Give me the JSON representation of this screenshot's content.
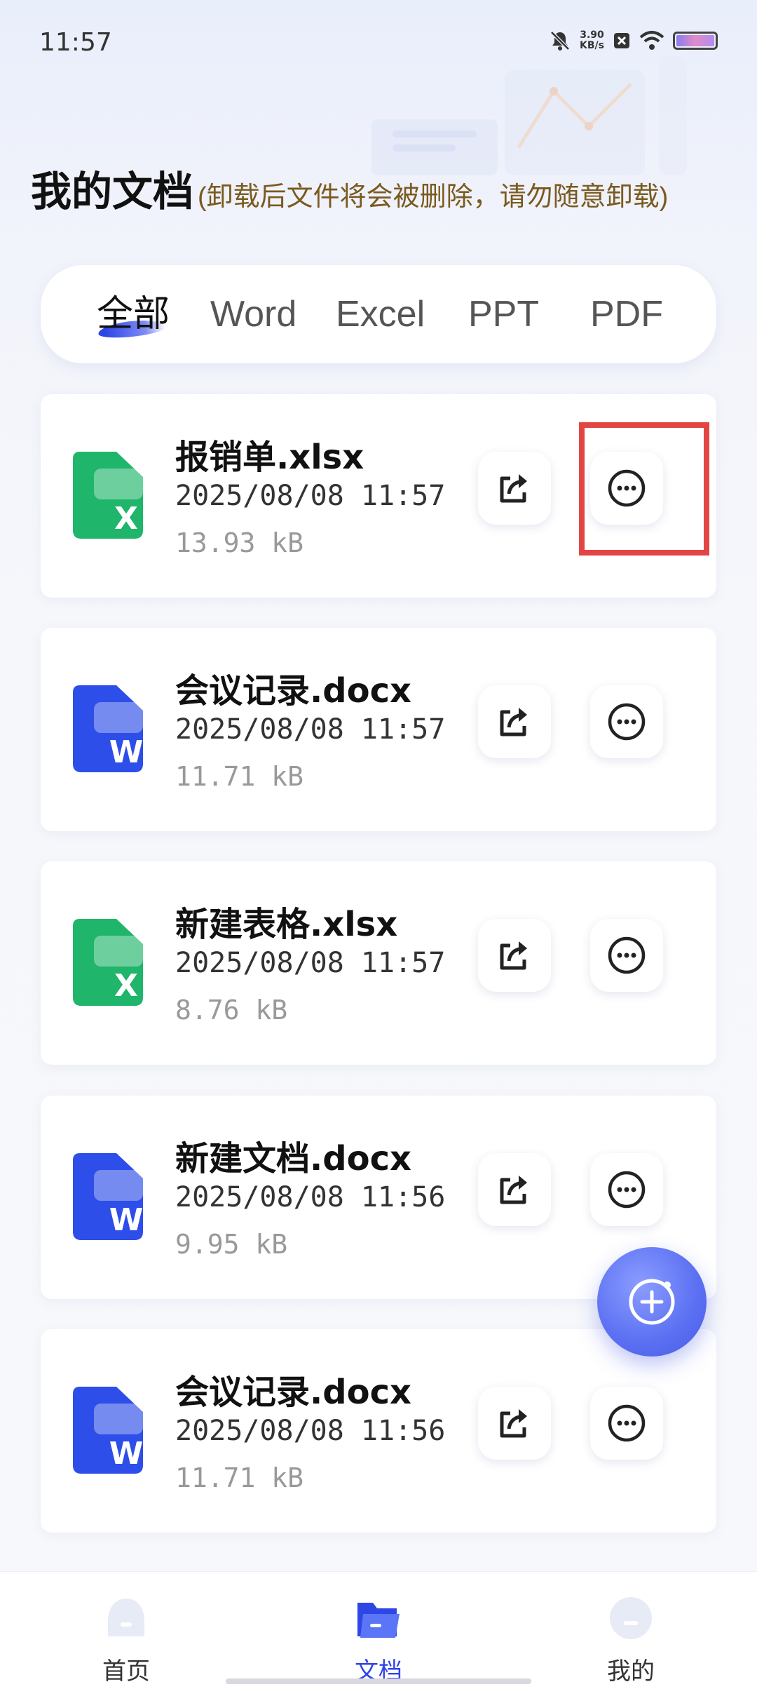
{
  "status_bar": {
    "time": "11:57",
    "speed_value": "3.90",
    "speed_unit": "KB/s",
    "icons": [
      "bell-off-icon",
      "sim-x-icon",
      "wifi-icon",
      "battery-icon"
    ]
  },
  "header": {
    "title": "我的文档",
    "note": "(卸载后文件将会被删除，请勿随意卸载)"
  },
  "tabs": [
    {
      "label": "全部",
      "active": true
    },
    {
      "label": "Word",
      "active": false
    },
    {
      "label": "Excel",
      "active": false
    },
    {
      "label": "PPT",
      "active": false
    },
    {
      "label": "PDF",
      "active": false
    }
  ],
  "files": [
    {
      "name": "报销单.xlsx",
      "date": "2025/08/08 11:57",
      "size": "13.93 kB",
      "type": "excel"
    },
    {
      "name": "会议记录.docx",
      "date": "2025/08/08 11:57",
      "size": "11.71 kB",
      "type": "word"
    },
    {
      "name": "新建表格.xlsx",
      "date": "2025/08/08 11:57",
      "size": "8.76 kB",
      "type": "excel"
    },
    {
      "name": "新建文档.docx",
      "date": "2025/08/08 11:56",
      "size": "9.95 kB",
      "type": "word"
    },
    {
      "name": "会议记录.docx",
      "date": "2025/08/08 11:56",
      "size": "11.71 kB",
      "type": "word"
    }
  ],
  "file_icon_letters": {
    "excel": "X",
    "word": "W"
  },
  "colors": {
    "excel": "#1fb56b",
    "word": "#2d4ee8",
    "accent": "#2f46e6",
    "highlight": "#e34545"
  },
  "fab_icon": "add-circle-icon",
  "nav": [
    {
      "label": "首页",
      "icon": "home-icon",
      "active": false
    },
    {
      "label": "文档",
      "icon": "folder-icon",
      "active": true
    },
    {
      "label": "我的",
      "icon": "profile-icon",
      "active": false
    }
  ]
}
